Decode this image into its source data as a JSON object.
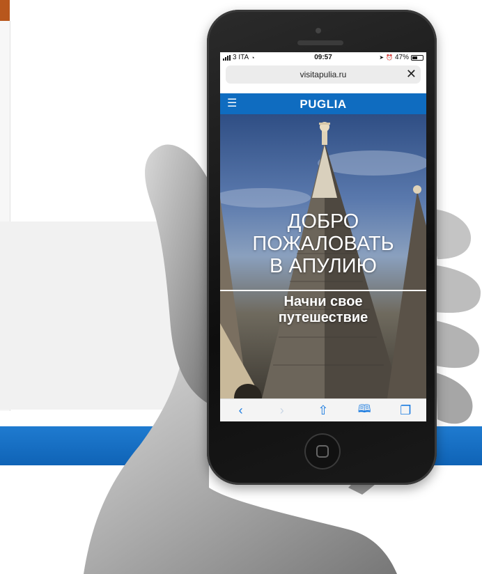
{
  "status_bar": {
    "carrier": "3 ITA",
    "time": "09:57",
    "battery": "47%"
  },
  "browser": {
    "url": "visitapulia.ru",
    "close_glyph": "✕"
  },
  "site": {
    "logo": "PUGLIA",
    "menu_glyph": "☰"
  },
  "hero": {
    "title_line1": "ДОБРО",
    "title_line2": "ПОЖАЛОВАТЬ",
    "title_line3": "В АПУЛИЮ",
    "cta_line1": "Начни свое",
    "cta_line2": "путешествие"
  },
  "toolbar": {
    "back": "‹",
    "forward": "›",
    "share": "⇧",
    "bookmarks": "📖",
    "tabs": "❐"
  },
  "colors": {
    "site_header": "#0f6cc0",
    "ios_blue": "#1a7be0",
    "bg_blue_band": "#1f7bd0"
  }
}
